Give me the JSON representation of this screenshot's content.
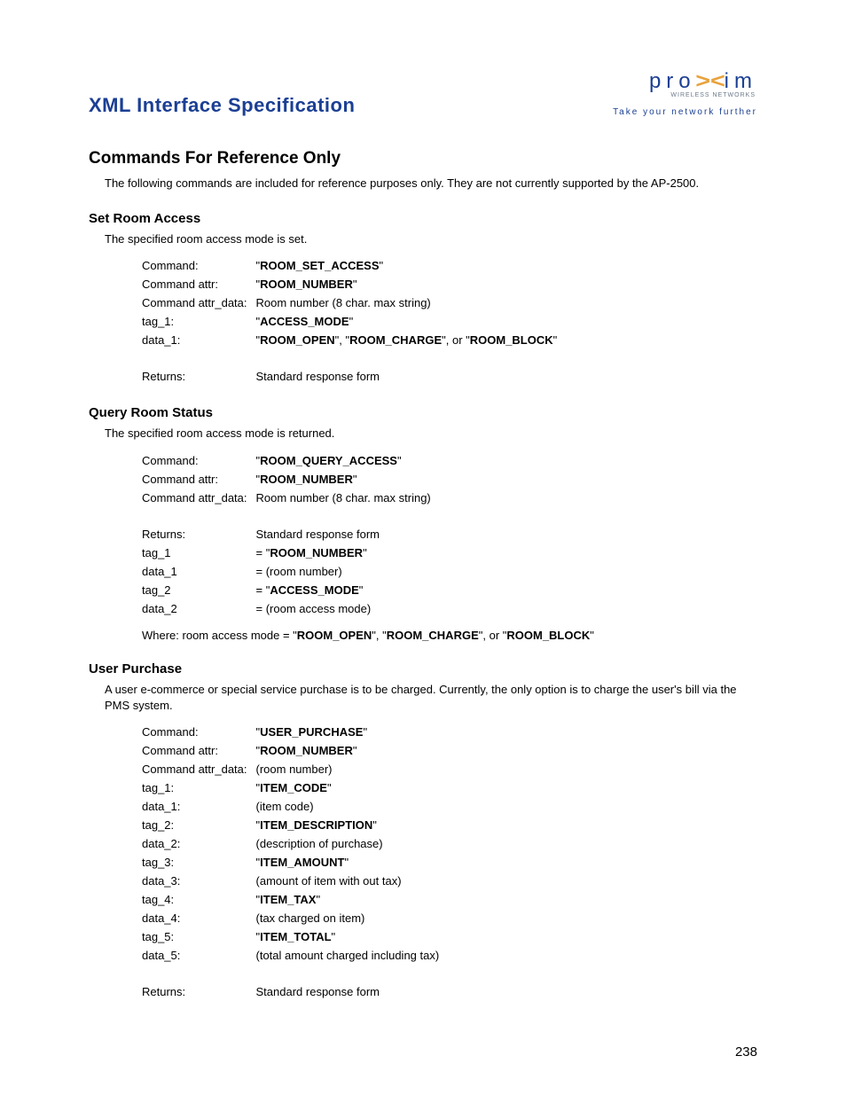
{
  "header": {
    "doc_title": "XML Interface Specification",
    "logo_brand": "proxim",
    "logo_subbrand": "WIRELESS NETWORKS",
    "logo_tagline": "Take your network further"
  },
  "page_number": "238",
  "section_title": "Commands For Reference Only",
  "section_intro": "The following commands are included for reference purposes only. They are not currently supported by the AP-2500.",
  "set_room": {
    "title": "Set Room Access",
    "desc": "The specified room access mode is set.",
    "rows": {
      "cmd_l": "Command:",
      "cmd_v": "ROOM_SET_ACCESS",
      "attr_l": "Command attr:",
      "attr_v": "ROOM_NUMBER",
      "attrd_l": "Command attr_data:",
      "attrd_v": "Room number (8 char. max string)",
      "t1_l": "tag_1:",
      "t1_v": "ACCESS_MODE",
      "d1_l": "data_1:",
      "d1_pre": "\"",
      "d1_a": "ROOM_OPEN",
      "d1_m1": "\", \"",
      "d1_b": "ROOM_CHARGE",
      "d1_m2": "\", or \"",
      "d1_c": "ROOM_BLOCK",
      "d1_post": "\"",
      "ret_l": "Returns:",
      "ret_v": "Standard response form"
    }
  },
  "query_room": {
    "title": "Query Room Status",
    "desc": "The specified room access mode is returned.",
    "rows": {
      "cmd_l": "Command:",
      "cmd_v": "ROOM_QUERY_ACCESS",
      "attr_l": "Command attr:",
      "attr_v": "ROOM_NUMBER",
      "attrd_l": "Command attr_data:",
      "attrd_v": "Room number (8 char. max string)",
      "ret_l": "Returns:",
      "ret_v": "Standard response form",
      "t1_l": "tag_1",
      "t1_eq": "= \"",
      "t1_v": "ROOM_NUMBER",
      "t1_post": "\"",
      "d1_l": "data_1",
      "d1_v": "= (room number)",
      "t2_l": "tag_2",
      "t2_eq": "= \"",
      "t2_v": "ACCESS_MODE",
      "t2_post": "\"",
      "d2_l": "data_2",
      "d2_v": "= (room access mode)"
    },
    "where_pre": "Where:  room access mode = \"",
    "where_a": "ROOM_OPEN",
    "where_m1": "\", \"",
    "where_b": "ROOM_CHARGE",
    "where_m2": "\", or \"",
    "where_c": "ROOM_BLOCK",
    "where_post": "\""
  },
  "user_purchase": {
    "title": "User Purchase",
    "desc": "A user e-commerce or special service purchase is to be charged. Currently, the only option is to charge the user's bill via the PMS system.",
    "rows": {
      "cmd_l": "Command:",
      "cmd_v": "USER_PURCHASE",
      "attr_l": "Command attr:",
      "attr_v": "ROOM_NUMBER",
      "attrd_l": "Command attr_data:",
      "attrd_v": "(room number)",
      "t1_l": "tag_1:",
      "t1_v": "ITEM_CODE",
      "d1_l": "data_1:",
      "d1_v": "(item code)",
      "t2_l": "tag_2:",
      "t2_v": "ITEM_DESCRIPTION",
      "d2_l": "data_2:",
      "d2_v": "(description of purchase)",
      "t3_l": "tag_3:",
      "t3_v": "ITEM_AMOUNT",
      "d3_l": "data_3:",
      "d3_v": "(amount of item with out tax)",
      "t4_l": "tag_4:",
      "t4_v": "ITEM_TAX",
      "d4_l": "data_4:",
      "d4_v": "(tax charged on item)",
      "t5_l": "tag_5:",
      "t5_v": "ITEM_TOTAL",
      "d5_l": "data_5:",
      "d5_v": "(total amount charged including tax)",
      "ret_l": "Returns:",
      "ret_v": "Standard response form"
    }
  }
}
